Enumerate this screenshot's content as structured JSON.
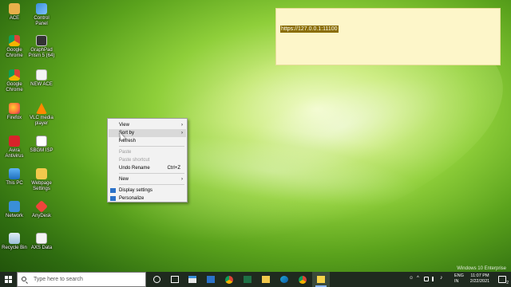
{
  "desktop": {
    "icons": [
      {
        "label": "ACE"
      },
      {
        "label": "Control Panel"
      },
      {
        "label": "Google Chrome"
      },
      {
        "label": "GraphPad Prism 5 (64)"
      },
      {
        "label": "Google Chrome"
      },
      {
        "label": "NEW ACE"
      },
      {
        "label": "Firefox"
      },
      {
        "label": "VLC media player"
      },
      {
        "label": "Avira Antivirus"
      },
      {
        "label": "SBGM ISP"
      },
      {
        "label": "This PC"
      },
      {
        "label": "Webpage Settings"
      },
      {
        "label": "Network"
      },
      {
        "label": "AnyDesk"
      },
      {
        "label": "Recycle Bin"
      },
      {
        "label": "AXS Data"
      }
    ],
    "watermark": "Windows 10 Enterprise"
  },
  "note": {
    "selected_text": "https://127.0.0.1:11100"
  },
  "context_menu": {
    "items": [
      {
        "label": "View",
        "submenu": "›"
      },
      {
        "label": "Sort by",
        "submenu": "›"
      },
      {
        "label": "Refresh"
      },
      {
        "label": "Paste"
      },
      {
        "label": "Paste shortcut"
      },
      {
        "label": "Undo Rename",
        "shortcut": "Ctrl+Z"
      },
      {
        "label": "New",
        "submenu": "›"
      },
      {
        "label": "Display settings"
      },
      {
        "label": "Personalize"
      }
    ]
  },
  "taskbar": {
    "search_placeholder": "Type here to search",
    "tray": {
      "language": "ENG",
      "region": "IN",
      "time": "11:07 PM",
      "date": "2/22/2021",
      "notification_count": "2"
    }
  },
  "colors": {
    "note_bg": "#fdf6c9",
    "selection": "#8a6d00",
    "taskbar": "#1f2a1f"
  }
}
